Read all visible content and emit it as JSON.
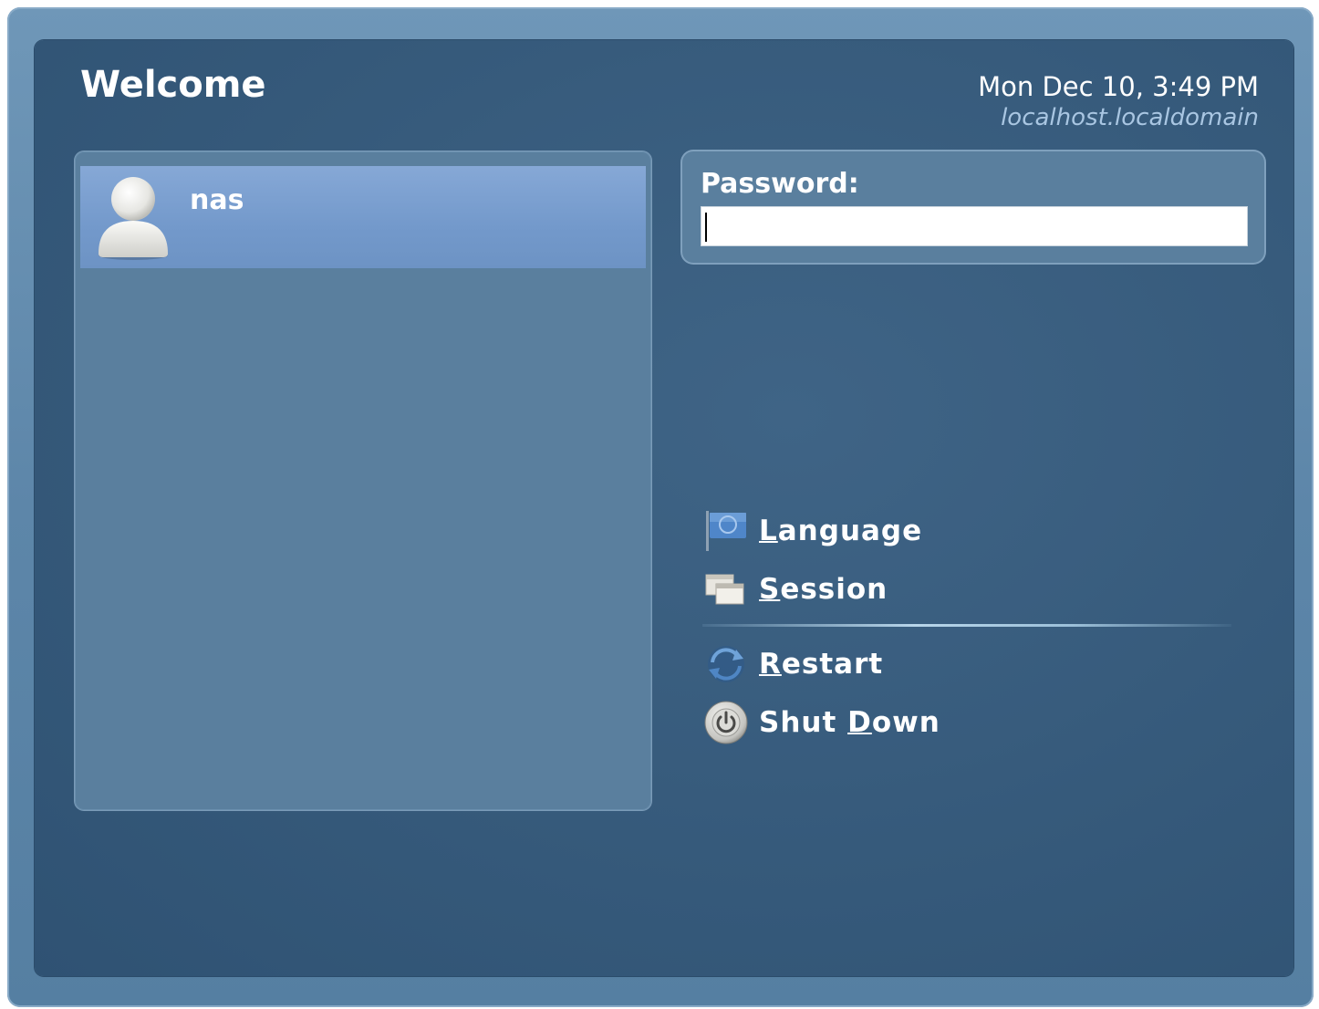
{
  "header": {
    "title": "Welcome",
    "datetime": "Mon Dec 10,  3:49 PM",
    "hostname": "localhost.localdomain"
  },
  "users": [
    {
      "name": "nas",
      "icon": "user-avatar-icon",
      "selected": true
    }
  ],
  "password": {
    "label": "Password:",
    "value": ""
  },
  "actions": {
    "language": {
      "mnemonic": "L",
      "rest": "anguage",
      "icon": "flag-icon"
    },
    "session": {
      "mnemonic": "S",
      "rest": "ession",
      "icon": "session-windows-icon"
    },
    "restart": {
      "mnemonic": "R",
      "rest": "estart",
      "icon": "restart-arrows-icon"
    },
    "shutdown": {
      "pre": "Shut ",
      "mnemonic": "D",
      "rest": "own",
      "icon": "power-icon"
    }
  },
  "colors": {
    "panel_bg": "#365a7b",
    "selection": "#7399cb",
    "text": "#ffffff",
    "hostname_text": "#a9c6e2"
  }
}
